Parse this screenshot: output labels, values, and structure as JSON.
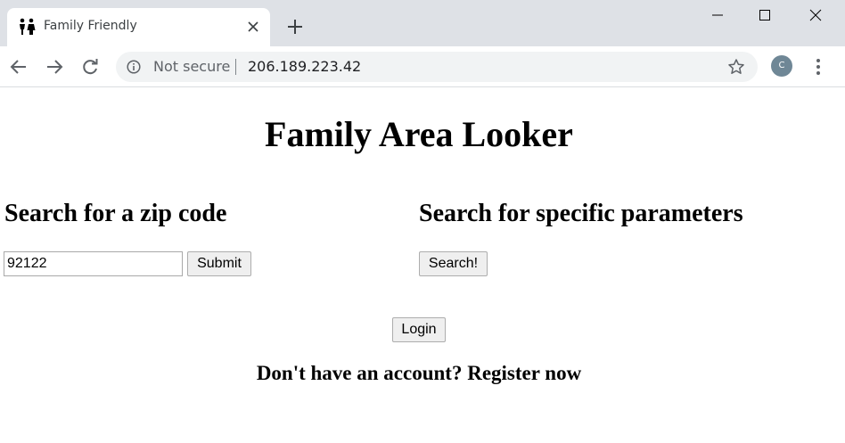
{
  "browser": {
    "tab": {
      "title": "Family Friendly",
      "favicon": "family-icon"
    },
    "new_tab_icon": "plus-icon",
    "window_controls": [
      "minimize-icon",
      "maximize-icon",
      "close-icon"
    ],
    "nav": {
      "back_icon": "arrow-left-icon",
      "forward_icon": "arrow-right-icon",
      "reload_icon": "reload-icon"
    },
    "address_bar": {
      "security_label": "Not secure",
      "url": "206.189.223.42",
      "bookmark_icon": "star-icon"
    },
    "profile_initial": "C",
    "profile_color": "#6f8796",
    "menu_icon": "kebab-menu-icon"
  },
  "page": {
    "title": "Family Area Looker",
    "zip_section": {
      "heading": "Search for a zip code",
      "input_value": "92122",
      "submit_label": "Submit"
    },
    "param_section": {
      "heading": "Search for specific parameters",
      "search_label": "Search!"
    },
    "login_label": "Login",
    "register_text": "Don't have an account? Register now"
  }
}
